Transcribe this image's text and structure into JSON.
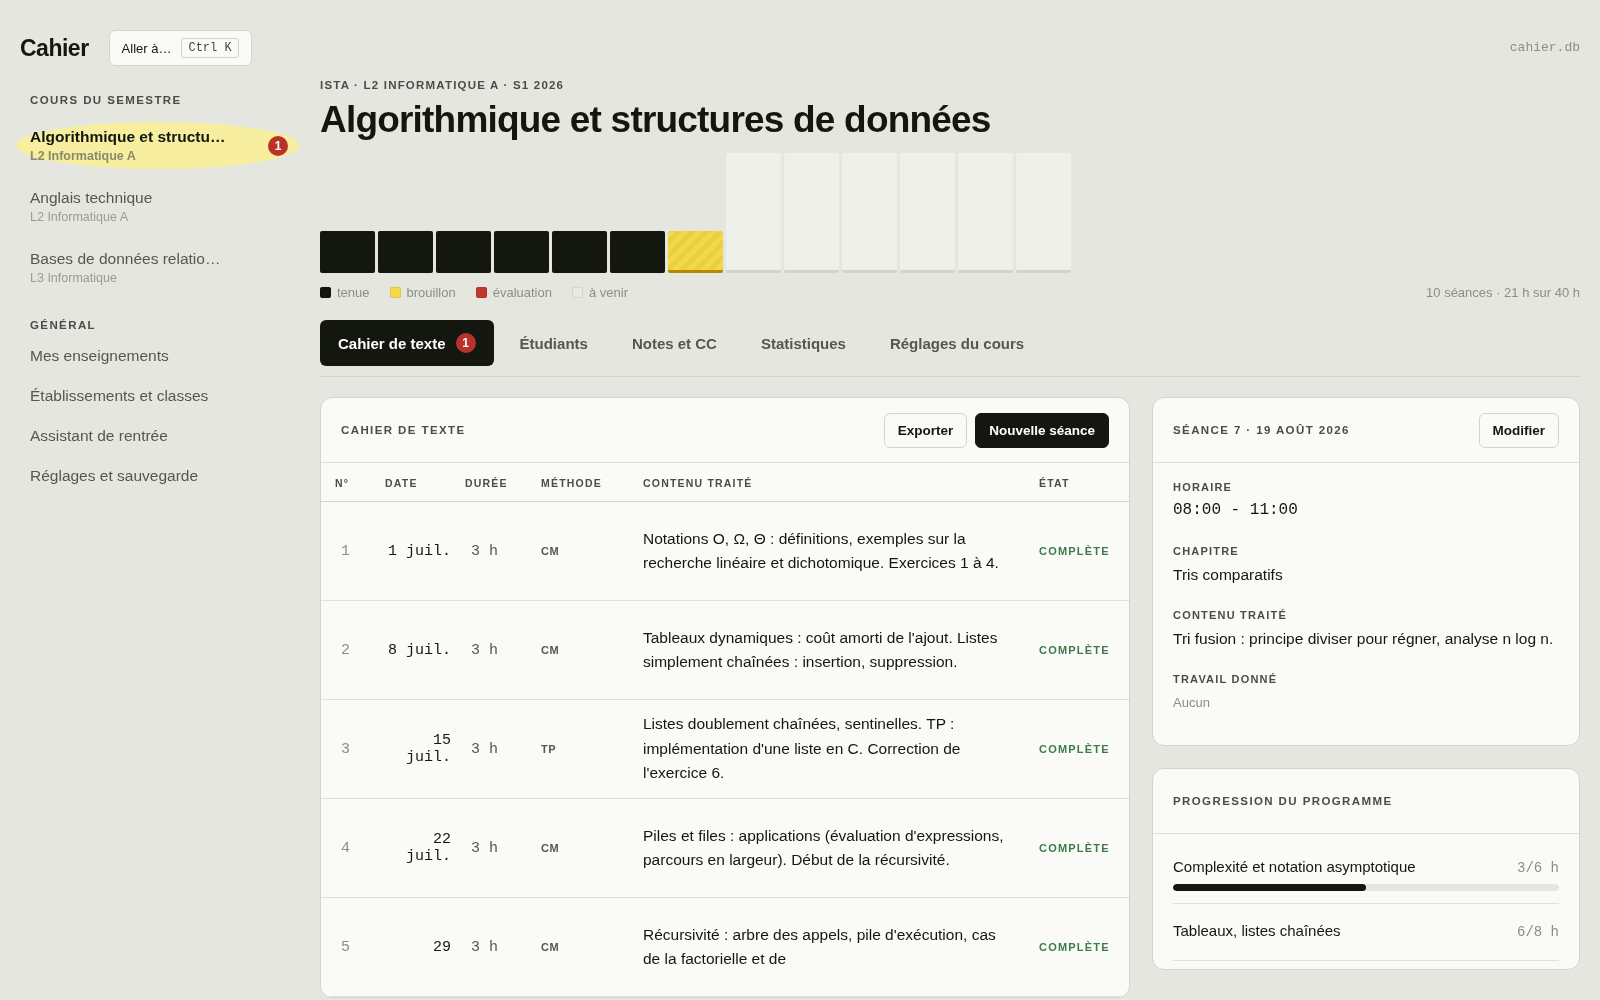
{
  "app": {
    "logo": "Cahier",
    "goto": {
      "label": "Aller à…",
      "shortcut": "Ctrl K"
    },
    "db": "cahier.db"
  },
  "sidebar": {
    "sections": [
      {
        "title": "COURS DU SEMESTRE",
        "items": [
          {
            "kind": "course",
            "name": "Algorithmique et structu…",
            "group": "L2 Informatique A",
            "selected": true,
            "badge": "1"
          },
          {
            "kind": "course",
            "name": "Anglais technique",
            "group": "L2 Informatique A",
            "selected": false
          },
          {
            "kind": "course",
            "name": "Bases de données relatio…",
            "group": "L3 Informatique",
            "selected": false
          }
        ]
      },
      {
        "title": "GÉNÉRAL",
        "items": [
          {
            "kind": "link",
            "name": "Mes enseignements",
            "selected": false
          },
          {
            "kind": "link",
            "name": "Établissements et classes",
            "selected": false
          },
          {
            "kind": "link",
            "name": "Assistant de rentrée",
            "selected": false
          },
          {
            "kind": "link",
            "name": "Réglages et sauvegarde",
            "selected": false
          }
        ]
      }
    ]
  },
  "header": {
    "breadcrumb": "ISTA · L2 INFORMATIQUE A · S1 2026",
    "title": "Algorithmique et structures de données"
  },
  "sessions": [
    {
      "kind": "held"
    },
    {
      "kind": "held"
    },
    {
      "kind": "held"
    },
    {
      "kind": "held"
    },
    {
      "kind": "held"
    },
    {
      "kind": "held"
    },
    {
      "kind": "draft"
    },
    {
      "kind": "upcoming"
    },
    {
      "kind": "upcoming"
    },
    {
      "kind": "upcoming"
    },
    {
      "kind": "upcoming"
    },
    {
      "kind": "upcoming"
    },
    {
      "kind": "upcoming"
    }
  ],
  "legend": [
    {
      "label": "tenue",
      "color": "#14170f"
    },
    {
      "label": "brouillon",
      "color": "#f2d94a"
    },
    {
      "label": "évaluation",
      "color": "#c0392b"
    },
    {
      "label": "à venir",
      "color": "#e9e9e2"
    }
  ],
  "summary": "10 séances · 21 h sur 40 h",
  "tabs": [
    {
      "label": "Cahier de texte",
      "selected": true,
      "badge": "1"
    },
    {
      "label": "Étudiants",
      "selected": false
    },
    {
      "label": "Notes et CC",
      "selected": false
    },
    {
      "label": "Statistiques",
      "selected": false
    },
    {
      "label": "Réglages du cours",
      "selected": false
    }
  ],
  "table": {
    "title": "CAHIER DE TEXTE",
    "buttons": [
      {
        "label": "Exporter",
        "kind": "secondary"
      },
      {
        "label": "Nouvelle séance",
        "kind": "primary"
      }
    ],
    "columns": [
      "N°",
      "DATE",
      "DURÉE",
      "MÉTHODE",
      "CONTENU TRAITÉ",
      "ÉTAT"
    ],
    "rows": [
      {
        "n": "1",
        "date": "1 juil.",
        "duration": "3 h",
        "method": "CM",
        "content": "Notations O, Ω, Θ : définitions, exemples sur la recherche linéaire et dichotomique. Exercices 1 à 4.",
        "state": "COMPLÈTE"
      },
      {
        "n": "2",
        "date": "8 juil.",
        "duration": "3 h",
        "method": "CM",
        "content": "Tableaux dynamiques : coût amorti de l'ajout. Listes simplement chaînées : insertion, suppression.",
        "state": "COMPLÈTE"
      },
      {
        "n": "3",
        "date": "15 juil.",
        "duration": "3 h",
        "method": "TP",
        "content": "Listes doublement chaînées, sentinelles. TP : implémentation d'une liste en C. Correction de l'exercice 6.",
        "state": "COMPLÈTE"
      },
      {
        "n": "4",
        "date": "22 juil.",
        "duration": "3 h",
        "method": "CM",
        "content": "Piles et files : applications (évaluation d'expressions, parcours en largeur). Début de la récursivité.",
        "state": "COMPLÈTE"
      },
      {
        "n": "5",
        "date": "29",
        "duration": "3 h",
        "method": "CM",
        "content": "Récursivité : arbre des appels, pile d'exécution, cas de la factorielle et de",
        "state": "COMPLÈTE"
      }
    ]
  },
  "session_detail": {
    "title": "SÉANCE 7 · 19 AOÛT 2026",
    "button": "Modifier",
    "fields": [
      {
        "kind": "mono",
        "label": "HORAIRE",
        "value": "08:00 - 11:00"
      },
      {
        "kind": "text",
        "label": "CHAPITRE",
        "value": "Tris comparatifs"
      },
      {
        "kind": "text",
        "label": "CONTENU TRAITÉ",
        "value": "Tri fusion : principe diviser pour régner, analyse n log n."
      },
      {
        "kind": "muted",
        "label": "TRAVAIL DONNÉ",
        "value": "Aucun"
      }
    ]
  },
  "progress": {
    "title": "PROGRESSION DU PROGRAMME",
    "items": [
      {
        "label": "Complexité et notation asymptotique",
        "hours": "3/6 h",
        "level": 0.5
      },
      {
        "label": "Tableaux, listes chaînées",
        "hours": "6/8 h"
      }
    ]
  }
}
